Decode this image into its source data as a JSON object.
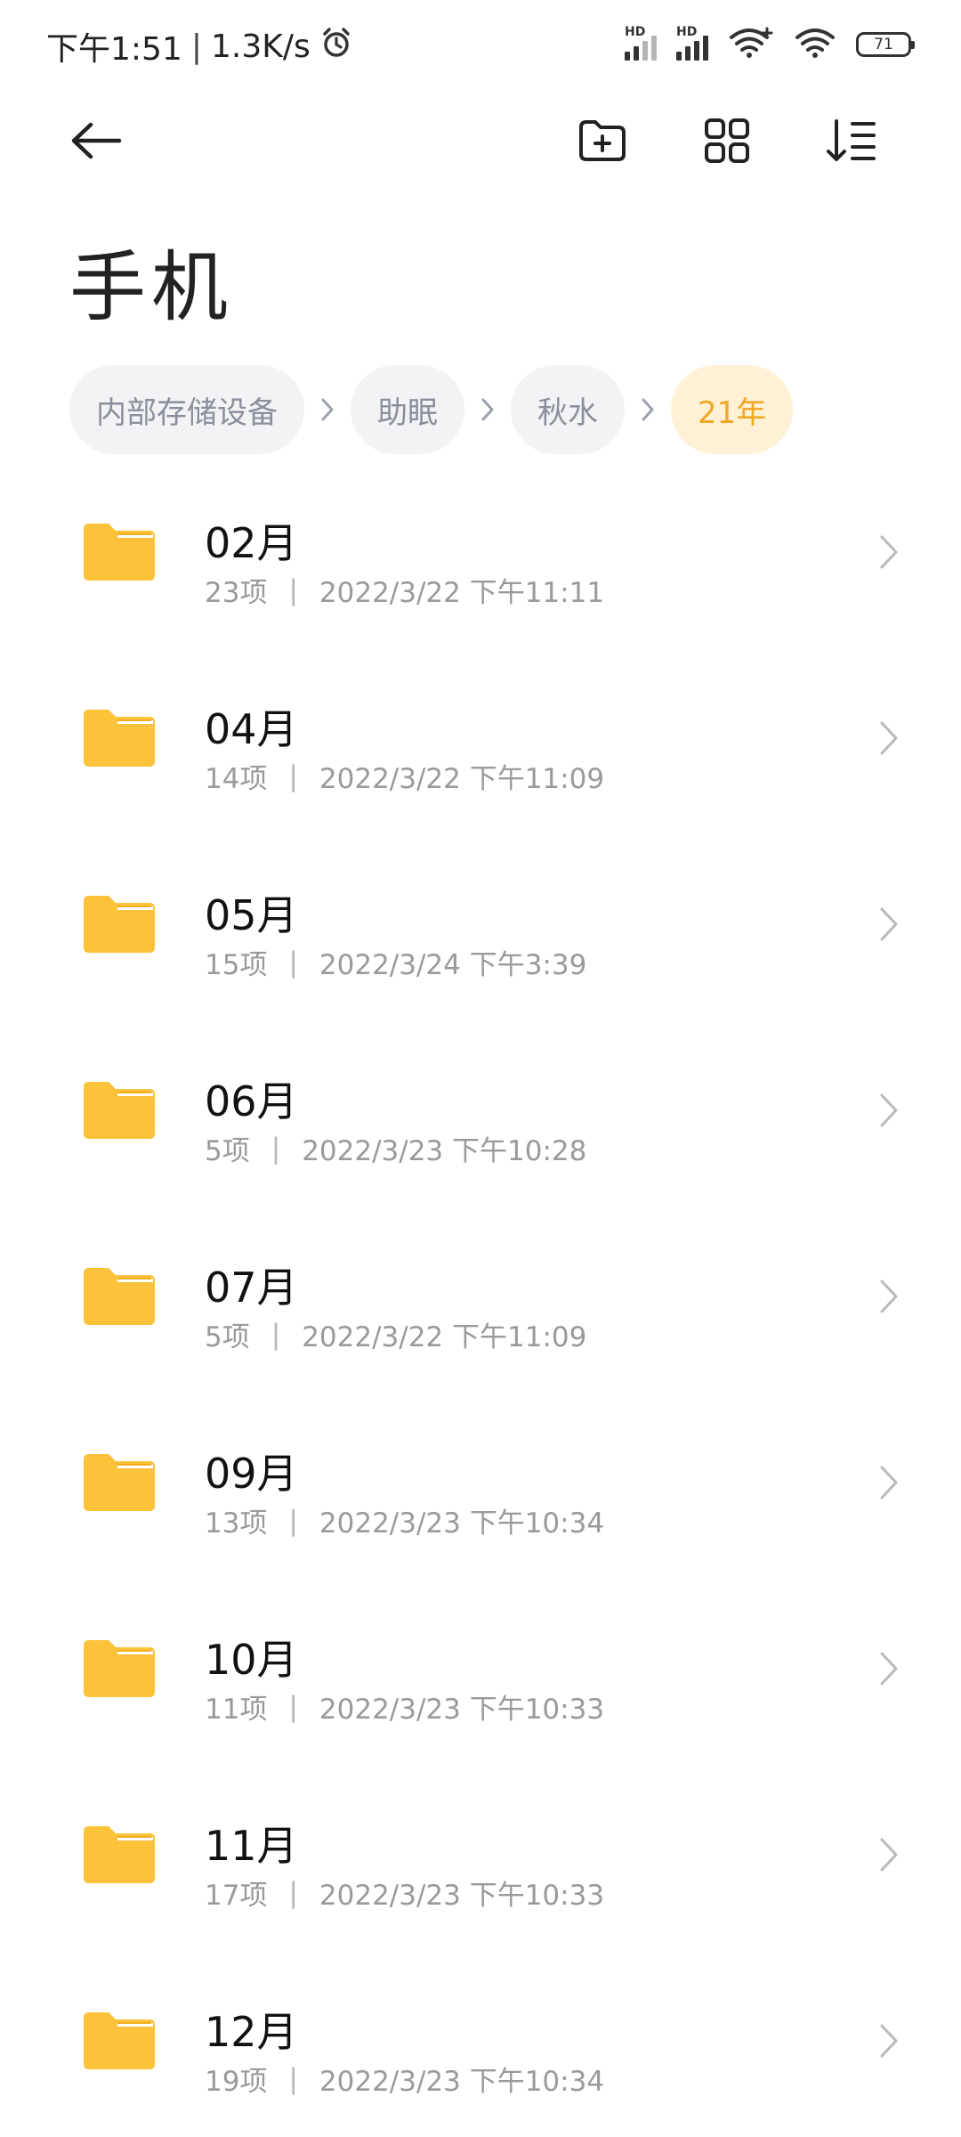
{
  "status_bar": {
    "time": "下午1:51",
    "speed": "1.3K/s",
    "battery": "71",
    "hd_label": "HD"
  },
  "page": {
    "title": "手机"
  },
  "breadcrumbs": [
    {
      "label": "内部存储设备",
      "active": false
    },
    {
      "label": "助眠",
      "active": false
    },
    {
      "label": "秋水",
      "active": false
    },
    {
      "label": "21年",
      "active": true
    }
  ],
  "folders": [
    {
      "name": "02月",
      "count": "23项",
      "modified": "2022/3/22 下午11:11"
    },
    {
      "name": "04月",
      "count": "14项",
      "modified": "2022/3/22 下午11:09"
    },
    {
      "name": "05月",
      "count": "15项",
      "modified": "2022/3/24 下午3:39"
    },
    {
      "name": "06月",
      "count": "5项",
      "modified": "2022/3/23 下午10:28"
    },
    {
      "name": "07月",
      "count": "5项",
      "modified": "2022/3/22 下午11:09"
    },
    {
      "name": "09月",
      "count": "13项",
      "modified": "2022/3/23 下午10:34"
    },
    {
      "name": "10月",
      "count": "11项",
      "modified": "2022/3/23 下午10:33"
    },
    {
      "name": "11月",
      "count": "17项",
      "modified": "2022/3/23 下午10:33"
    },
    {
      "name": "12月",
      "count": "19项",
      "modified": "2022/3/23 下午10:34"
    }
  ],
  "meta_separator": "|",
  "colors": {
    "folder": "#fcc239",
    "folder_tab": "#f3ae21",
    "accent": "#f0a722",
    "accent_bg": "#fff1d6",
    "crumb_bg": "#f3f3f5",
    "secondary_text": "#9a9a9a"
  },
  "icons": {
    "back": "arrow-left-icon",
    "new_folder": "folder-plus-icon",
    "view": "grid-view-icon",
    "sort": "sort-icon",
    "alarm": "alarm-icon",
    "wifi": "wifi-icon"
  }
}
